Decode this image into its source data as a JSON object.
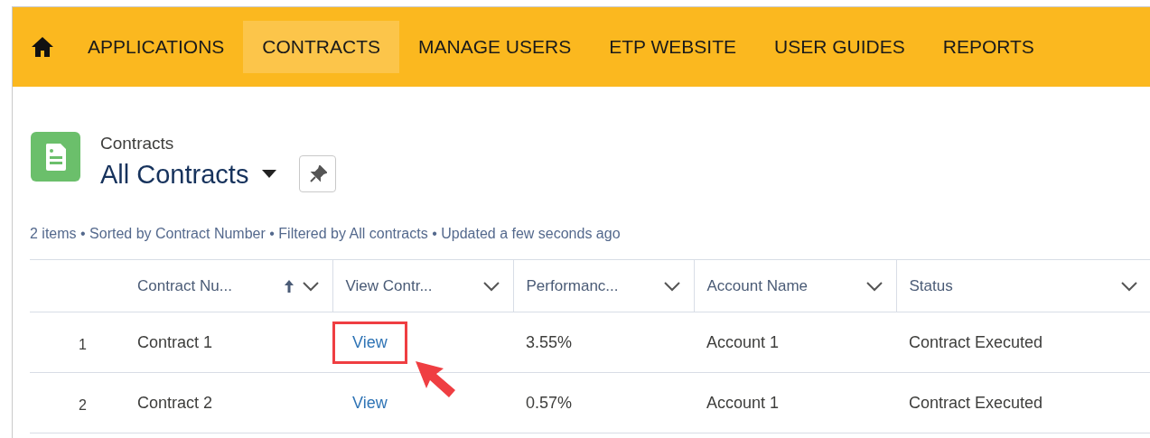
{
  "nav": {
    "items": [
      {
        "label": "APPLICATIONS",
        "selected": false
      },
      {
        "label": "CONTRACTS",
        "selected": true
      },
      {
        "label": "MANAGE USERS",
        "selected": false
      },
      {
        "label": "ETP WEBSITE",
        "selected": false
      },
      {
        "label": "USER GUIDES",
        "selected": false
      },
      {
        "label": "REPORTS",
        "selected": false
      }
    ]
  },
  "list_header": {
    "object": "Contracts",
    "view_name": "All Contracts",
    "info": "2 items • Sorted by Contract Number • Filtered by All contracts • Updated a few seconds ago"
  },
  "table": {
    "columns": [
      {
        "label": "Contract Nu...",
        "sorted": true
      },
      {
        "label": "View Contr...",
        "sorted": false
      },
      {
        "label": "Performanc...",
        "sorted": false
      },
      {
        "label": "Account Name",
        "sorted": false
      },
      {
        "label": "Status",
        "sorted": false
      }
    ],
    "rows": [
      {
        "number": "1",
        "cells": [
          "Contract 1",
          "View",
          "3.55%",
          "Account 1",
          "Contract Executed"
        ],
        "highlighted": true
      },
      {
        "number": "2",
        "cells": [
          "Contract 2",
          "View",
          "0.57%",
          "Account 1",
          "Contract Executed"
        ],
        "highlighted": false
      }
    ]
  }
}
